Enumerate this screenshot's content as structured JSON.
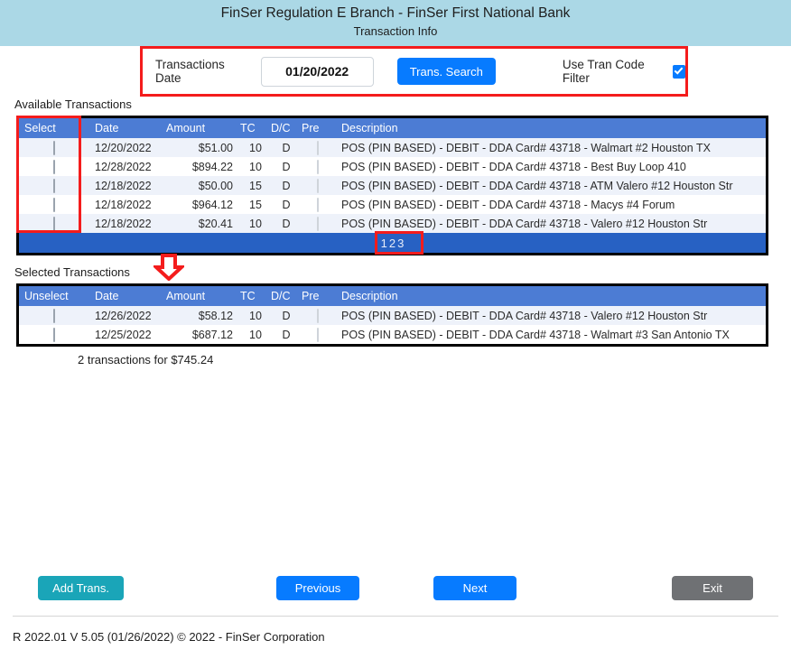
{
  "banner": {
    "title": "FinSer Regulation E Branch - FinSer First National Bank",
    "subtitle": "Transaction Info"
  },
  "search": {
    "date_label": "Transactions Date",
    "date_value": "01/20/2022",
    "search_button": "Trans. Search",
    "filter_label": "Use Tran Code Filter",
    "filter_checked": true
  },
  "available": {
    "caption": "Available Transactions",
    "columns": [
      "Select",
      "Date",
      "Amount",
      "TC",
      "D/C",
      "Pre",
      "Description"
    ],
    "rows": [
      {
        "select": false,
        "date": "12/20/2022",
        "amount": "$51.00",
        "tc": "10",
        "dc": "D",
        "pre": false,
        "description": "POS (PIN BASED) - DEBIT - DDA Card# 43718 - Walmart #2 Houston TX"
      },
      {
        "select": false,
        "date": "12/28/2022",
        "amount": "$894.22",
        "tc": "10",
        "dc": "D",
        "pre": false,
        "description": "POS (PIN BASED) - DEBIT - DDA Card# 43718 - Best Buy Loop 410"
      },
      {
        "select": false,
        "date": "12/18/2022",
        "amount": "$50.00",
        "tc": "15",
        "dc": "D",
        "pre": false,
        "description": "POS (PIN BASED) - DEBIT - DDA Card# 43718 - ATM Valero #12 Houston Str"
      },
      {
        "select": false,
        "date": "12/18/2022",
        "amount": "$964.12",
        "tc": "15",
        "dc": "D",
        "pre": false,
        "description": "POS (PIN BASED) - DEBIT - DDA Card# 43718 - Macys #4 Forum"
      },
      {
        "select": false,
        "date": "12/18/2022",
        "amount": "$20.41",
        "tc": "10",
        "dc": "D",
        "pre": false,
        "description": "POS (PIN BASED) - DEBIT - DDA Card# 43718 - Valero #12 Houston Str"
      }
    ],
    "pages": [
      "1",
      "2",
      "3"
    ]
  },
  "selected": {
    "caption": "Selected Transactions",
    "columns": [
      "Unselect",
      "Date",
      "Amount",
      "TC",
      "D/C",
      "Pre",
      "Description"
    ],
    "rows": [
      {
        "select": false,
        "date": "12/26/2022",
        "amount": "$58.12",
        "tc": "10",
        "dc": "D",
        "pre": false,
        "description": "POS (PIN BASED) - DEBIT - DDA Card# 43718 - Valero #12 Houston Str"
      },
      {
        "select": false,
        "date": "12/25/2022",
        "amount": "$687.12",
        "tc": "10",
        "dc": "D",
        "pre": false,
        "description": "POS (PIN BASED) - DEBIT - DDA Card# 43718 - Walmart #3 San Antonio TX"
      }
    ],
    "totals": "2 transactions for $745.24"
  },
  "buttons": {
    "add": "Add Trans.",
    "previous": "Previous",
    "next": "Next",
    "exit": "Exit"
  },
  "footer": "R 2022.01 V 5.05 (01/26/2022) © 2022 - FinSer Corporation",
  "colors": {
    "banner_bg": "#abd8e6",
    "grid_header": "#4c7cd4",
    "pager_bg": "#2761c3",
    "primary_button": "#077bff",
    "add_button": "#1aa5b8",
    "exit_button": "#6f7174",
    "annotation": "#f41c1c",
    "row_stripe": "#eef2fa"
  }
}
